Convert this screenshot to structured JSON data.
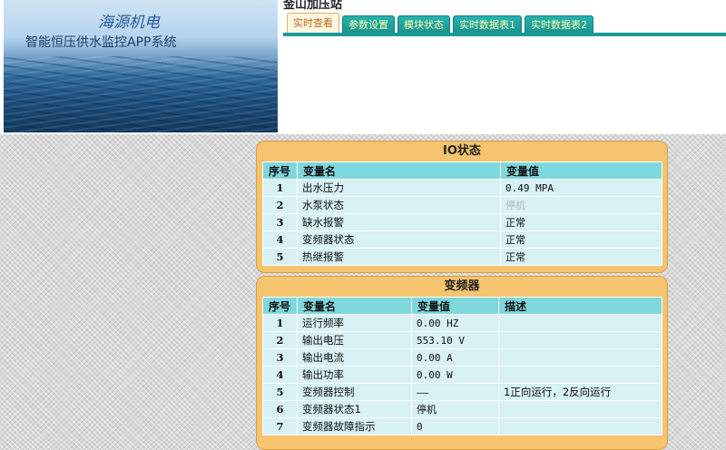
{
  "header": {
    "brand": "海源机电",
    "app_name": "智能恒压供水监控APP系统",
    "page_title": "金山加压站",
    "tabs": [
      "实时查看",
      "参数设置",
      "模块状态",
      "实时数据表1",
      "实时数据表2"
    ],
    "active_tab": 0
  },
  "io_panel": {
    "title": "IO状态",
    "headers": [
      "序号",
      "变量名",
      "变量值"
    ],
    "rows": [
      {
        "idx": "1",
        "name": "出水压力",
        "value": "0.49 MPA"
      },
      {
        "idx": "2",
        "name": "水泵状态",
        "value": "停机"
      },
      {
        "idx": "3",
        "name": "缺水报警",
        "value": "正常"
      },
      {
        "idx": "4",
        "name": "变频器状态",
        "value": "正常"
      },
      {
        "idx": "5",
        "name": "热继报警",
        "value": "正常"
      }
    ]
  },
  "vfd_panel": {
    "title": "变频器",
    "headers": [
      "序号",
      "变量名",
      "变量值",
      "描述"
    ],
    "rows": [
      {
        "idx": "1",
        "name": "运行频率",
        "value": "0.00 HZ",
        "desc": ""
      },
      {
        "idx": "2",
        "name": "输出电压",
        "value": "553.10 V",
        "desc": ""
      },
      {
        "idx": "3",
        "name": "输出电流",
        "value": "0.00 A",
        "desc": ""
      },
      {
        "idx": "4",
        "name": "输出功率",
        "value": "0.00 W",
        "desc": ""
      },
      {
        "idx": "5",
        "name": "变频器控制",
        "value": "——",
        "desc": "1正向运行，2反向运行"
      },
      {
        "idx": "6",
        "name": "变频器状态1",
        "value": "停机",
        "desc": ""
      },
      {
        "idx": "7",
        "name": "变频器故障指示",
        "value": "0",
        "desc": ""
      }
    ]
  }
}
